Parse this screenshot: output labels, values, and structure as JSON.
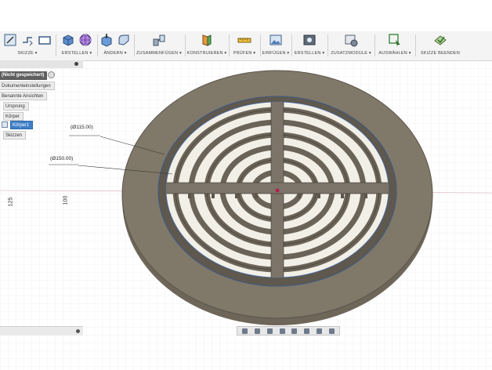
{
  "toolbar": {
    "groups": [
      {
        "label": "SKIZZE ▾",
        "icons": [
          "sketch-icon",
          "line-icon",
          "rectangle-icon"
        ]
      },
      {
        "label": "ERSTELLEN ▾",
        "icons": [
          "box-icon",
          "sphere-icon"
        ]
      },
      {
        "label": "ÄNDERN ▾",
        "icons": [
          "press-pull-icon",
          "fillet-icon"
        ]
      },
      {
        "label": "ZUSAMMENFÜGEN ▾",
        "icons": [
          "joint-icon"
        ]
      },
      {
        "label": "KONSTRUIEREN ▾",
        "icons": [
          "plane-icon"
        ]
      },
      {
        "label": "PRÜFEN ▾",
        "icons": [
          "measure-icon"
        ]
      },
      {
        "label": "EINFÜGEN ▾",
        "icons": [
          "insert-image-icon"
        ]
      },
      {
        "label": "ERSTELLEN ▾",
        "icons": [
          "render-icon"
        ]
      },
      {
        "label": "ZUSATZMODULE ▾",
        "icons": [
          "addins-icon"
        ]
      },
      {
        "label": "AUSWÄHLEN ▾",
        "icons": [
          "select-icon"
        ]
      },
      {
        "label": "SKIZZE BEENDEN",
        "icons": [
          "stop-sketch-icon"
        ]
      }
    ]
  },
  "browser": {
    "document_title": "(Nicht gespeichert)",
    "nodes": [
      {
        "label": "Dokumenteinstellungen",
        "selected": false
      },
      {
        "label": "Benannte Ansichten",
        "selected": false
      },
      {
        "label": "Ursprung",
        "selected": false
      },
      {
        "label": "Körper",
        "selected": false
      },
      {
        "label": "Körper1",
        "selected": true
      },
      {
        "label": "Skizzen",
        "selected": false
      }
    ]
  },
  "viewport": {
    "dimensions": [
      "(Ø115.00)",
      "(Ø150.00)"
    ],
    "axis_labels": [
      "125",
      "100"
    ]
  },
  "colors": {
    "toolbar_bg": "#f4f4f4",
    "model_body": "#7a7266",
    "model_top": "#6e675c",
    "grid": "#e2e2e2",
    "selection": "#3d7ec6"
  }
}
